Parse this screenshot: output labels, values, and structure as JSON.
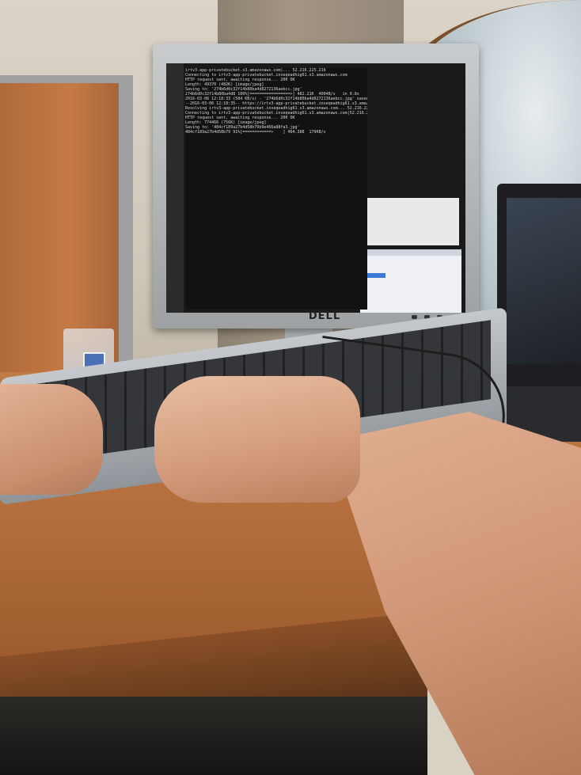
{
  "scene": {
    "description_kind": "photo",
    "monitor_brand": "DELL"
  },
  "screen": {
    "terminal_lines": [
      "irtv3-app-privatebucket.s3.amazonaws.com)... 52.216.225.216",
      "Connecting to irtv3-app-privatebucket.inseqeadhig61.s3.amazonaws.com",
      "HTTP request sent, awaiting response... 200 OK",
      "Length: 49370 (482K) [image/jpeg]",
      "Saving to: '274b6d0c32f14b80ba4d8272136aebcc.jpg'",
      "",
      "274b6d0c32f14b80ba4d8 100%[=================>] 482.21K  4004B/s   in 0.8s",
      "",
      "2016-03-06 12:18:33 (584 KB/s) - '274b6d0c32f14b80ba4d8272136aebcc.jpg' saved",
      "",
      "--2016-03-06 12:18:35-- https://irtv3-app-privatebucket.inseqeadhig61.s3.amazo",
      "Resolving irtv3-app-privatebucket.inseqeadhig61.s3.amazonaws.com... 52.216.225.216",
      "Connecting to irtv3-app-privatebucket.inseqeadhig61.s3.amazonaws.com|52.216.225",
      "HTTP request sent, awaiting response... 200 OK",
      "Length: 774466 (756K) [image/jpeg]",
      "Saving to: '484cf189a27b4d58b79b9e466a88fa3.jpg'",
      "",
      "484cf189a27b4d58b79 91%[============>    ] 464,388  179KB/s"
    ]
  }
}
